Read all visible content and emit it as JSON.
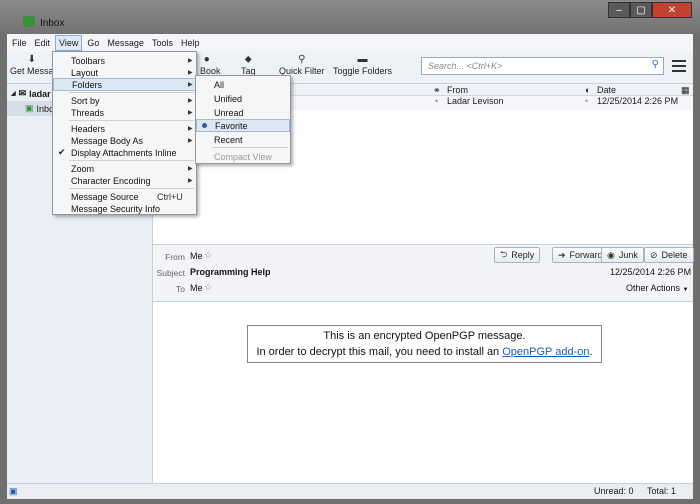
{
  "window": {
    "title": "Inbox",
    "controls": {
      "minimize": "–",
      "maximize": "▢",
      "close": "✕"
    }
  },
  "menubar": [
    "File",
    "Edit",
    "View",
    "Go",
    "Message",
    "Tools",
    "Help"
  ],
  "toolbar": {
    "get_messages": "Get Messa",
    "address_book": "s Book",
    "tag": "Tag",
    "quick_filter": "Quick Filter",
    "toggle_folders": "Toggle Folders",
    "search_placeholder": "Search... <Ctrl+K>"
  },
  "folders": {
    "account": "ladar",
    "inbox": "Inbox"
  },
  "thread_columns": {
    "from": "From",
    "date": "Date"
  },
  "thread_rows": [
    {
      "from": "Ladar Levison",
      "date": "12/25/2014 2:26 PM"
    }
  ],
  "message": {
    "from_label": "From",
    "from_value": "Me",
    "subject_label": "Subject",
    "subject_value": "Programming Help",
    "to_label": "To",
    "to_value": "Me",
    "date": "12/25/2014 2:26 PM",
    "other_actions": "Other Actions",
    "buttons": {
      "reply": "Reply",
      "forward": "Forward",
      "junk": "Junk",
      "delete": "Delete"
    }
  },
  "body": {
    "line1": "This is an encrypted OpenPGP message.",
    "line2_prefix": "In order to decrypt this mail, you need to install an ",
    "link": "OpenPGP add-on",
    "line2_suffix": "."
  },
  "status": {
    "unread": "Unread: 0",
    "total": "Total: 1"
  },
  "view_menu": [
    "Toolbars",
    "Layout",
    "Folders",
    "Sort by",
    "Threads",
    "Headers",
    "Message Body As",
    "Display Attachments Inline",
    "Zoom",
    "Character Encoding",
    "Message Source",
    "Message Security Info"
  ],
  "view_menu_accel": {
    "message_source": "Ctrl+U"
  },
  "folders_submenu": [
    "All",
    "Unified",
    "Unread",
    "Favorite",
    "Recent",
    "Compact View"
  ]
}
